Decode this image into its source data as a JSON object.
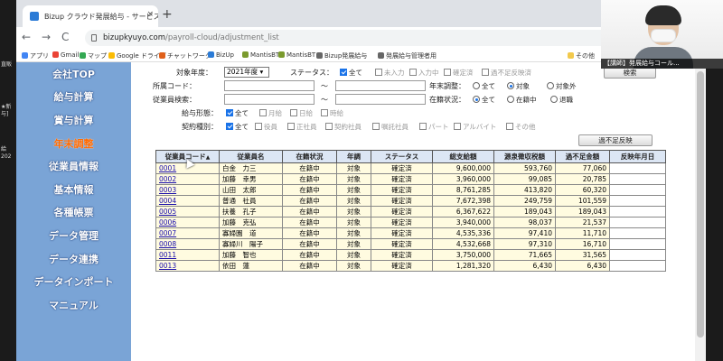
{
  "left_strip": [
    "直販",
    "★新",
    "与]",
    "給",
    "202"
  ],
  "webcam": {
    "caption": "【講師】発展給与コール..."
  },
  "browser": {
    "tab_title": "Bizup クラウド発展給与 - サービス",
    "tab_close": "×",
    "new_tab": "+",
    "nav": {
      "back": "←",
      "forward": "→",
      "reload": "C"
    },
    "url_host": "bizupkyuyo.com",
    "url_path": "/payroll-cloud/adjustment_list",
    "bookmarks": [
      {
        "label": "アプリ",
        "color": "#4285f4"
      },
      {
        "label": "Gmail",
        "color": "#ea4335"
      },
      {
        "label": "マップ",
        "color": "#34a853"
      },
      {
        "label": "Google ドライブ",
        "color": "#fbbc05"
      },
      {
        "label": "チャットワーク",
        "color": "#e0601b"
      },
      {
        "label": "BizUp",
        "color": "#2b7bd6"
      },
      {
        "label": "MantisBT",
        "color": "#7a9a2d"
      },
      {
        "label": "MantisBT",
        "color": "#7a9a2d"
      },
      {
        "label": "Bizup発展給与",
        "color": "#666666"
      },
      {
        "label": "発展給与管理者用",
        "color": "#666666"
      },
      {
        "label": "その他",
        "color": "#f2c94c"
      }
    ]
  },
  "sidebar": {
    "items": [
      {
        "label": "会社TOP",
        "active": false
      },
      {
        "label": "給与計算",
        "active": false
      },
      {
        "label": "賞与計算",
        "active": false
      },
      {
        "label": "年末調整",
        "active": true
      },
      {
        "label": "従業員情報",
        "active": false
      },
      {
        "label": "基本情報",
        "active": false
      },
      {
        "label": "各種帳票",
        "active": false
      },
      {
        "label": "データ管理",
        "active": false
      },
      {
        "label": "データ連携",
        "active": false
      },
      {
        "label": "データインポート",
        "active": false
      },
      {
        "label": "マニュアル",
        "active": false
      }
    ]
  },
  "filters": {
    "year_label": "対象年度：",
    "year_value": "2021年度",
    "status_label": "ステータス：",
    "status_options": [
      {
        "label": "全て",
        "checked": true
      },
      {
        "label": "未入力",
        "checked": false
      },
      {
        "label": "入力中",
        "checked": false
      },
      {
        "label": "確定済",
        "checked": false
      },
      {
        "label": "過不足反映済",
        "checked": false
      }
    ],
    "search_button": "検索",
    "dept_label": "所属コード：",
    "tilde": "～",
    "ye_label": "年末調整：",
    "ye_options": [
      {
        "label": "全て",
        "checked": false
      },
      {
        "label": "対象",
        "checked": true
      },
      {
        "label": "対象外",
        "checked": false
      }
    ],
    "emp_label": "従業員検索：",
    "emp_status_label": "在籍状況：",
    "emp_status_options": [
      {
        "label": "全て",
        "checked": true
      },
      {
        "label": "在籍中",
        "checked": false
      },
      {
        "label": "退職",
        "checked": false
      }
    ],
    "pay_label": "給与形態：",
    "pay_options": [
      {
        "label": "全て",
        "checked": true
      },
      {
        "label": "月給",
        "checked": false
      },
      {
        "label": "日給",
        "checked": false
      },
      {
        "label": "時給",
        "checked": false
      }
    ],
    "contract_label": "契約種別：",
    "contract_options": [
      {
        "label": "全て",
        "checked": true
      },
      {
        "label": "役員",
        "checked": false
      },
      {
        "label": "正社員",
        "checked": false
      },
      {
        "label": "契約社員",
        "checked": false
      },
      {
        "label": "嘱託社員",
        "checked": false
      },
      {
        "label": "パート",
        "checked": false
      },
      {
        "label": "アルバイト",
        "checked": false
      },
      {
        "label": "その他",
        "checked": false
      }
    ],
    "apply_button": "過不足反映"
  },
  "table": {
    "headers": [
      "従業員コード",
      "従業員名",
      "在籍状況",
      "年調",
      "ステータス",
      "総支給額",
      "源泉徴収税額",
      "過不足金額",
      "反映年月日"
    ],
    "sort_indicator": "▲",
    "rows": [
      [
        "0001",
        "白金　力三",
        "在籍中",
        "対象",
        "確定済",
        "9,600,000",
        "593,760",
        "77,060",
        ""
      ],
      [
        "0002",
        "加藤　幸男",
        "在籍中",
        "対象",
        "確定済",
        "3,960,000",
        "99,085",
        "20,785",
        ""
      ],
      [
        "0003",
        "山田　太郎",
        "在籍中",
        "対象",
        "確定済",
        "8,761,285",
        "413,820",
        "60,320",
        ""
      ],
      [
        "0004",
        "普通　社員",
        "在籍中",
        "対象",
        "確定済",
        "7,672,398",
        "249,759",
        "101,559",
        ""
      ],
      [
        "0005",
        "扶養　孔子",
        "在籍中",
        "対象",
        "確定済",
        "6,367,622",
        "189,043",
        "189,043",
        ""
      ],
      [
        "0006",
        "加藤　克弘",
        "在籍中",
        "対象",
        "確定済",
        "3,940,000",
        "98,037",
        "21,537",
        ""
      ],
      [
        "0007",
        "寡婦園　道",
        "在籍中",
        "対象",
        "確定済",
        "4,535,336",
        "97,410",
        "11,710",
        ""
      ],
      [
        "0008",
        "寡婦川　陽子",
        "在籍中",
        "対象",
        "確定済",
        "4,532,668",
        "97,310",
        "16,710",
        ""
      ],
      [
        "0011",
        "加藤　智也",
        "在籍中",
        "対象",
        "確定済",
        "3,750,000",
        "71,665",
        "31,565",
        ""
      ],
      [
        "0013",
        "依田　蓮",
        "在籍中",
        "対象",
        "確定済",
        "1,281,320",
        "6,430",
        "6,430",
        ""
      ]
    ]
  }
}
